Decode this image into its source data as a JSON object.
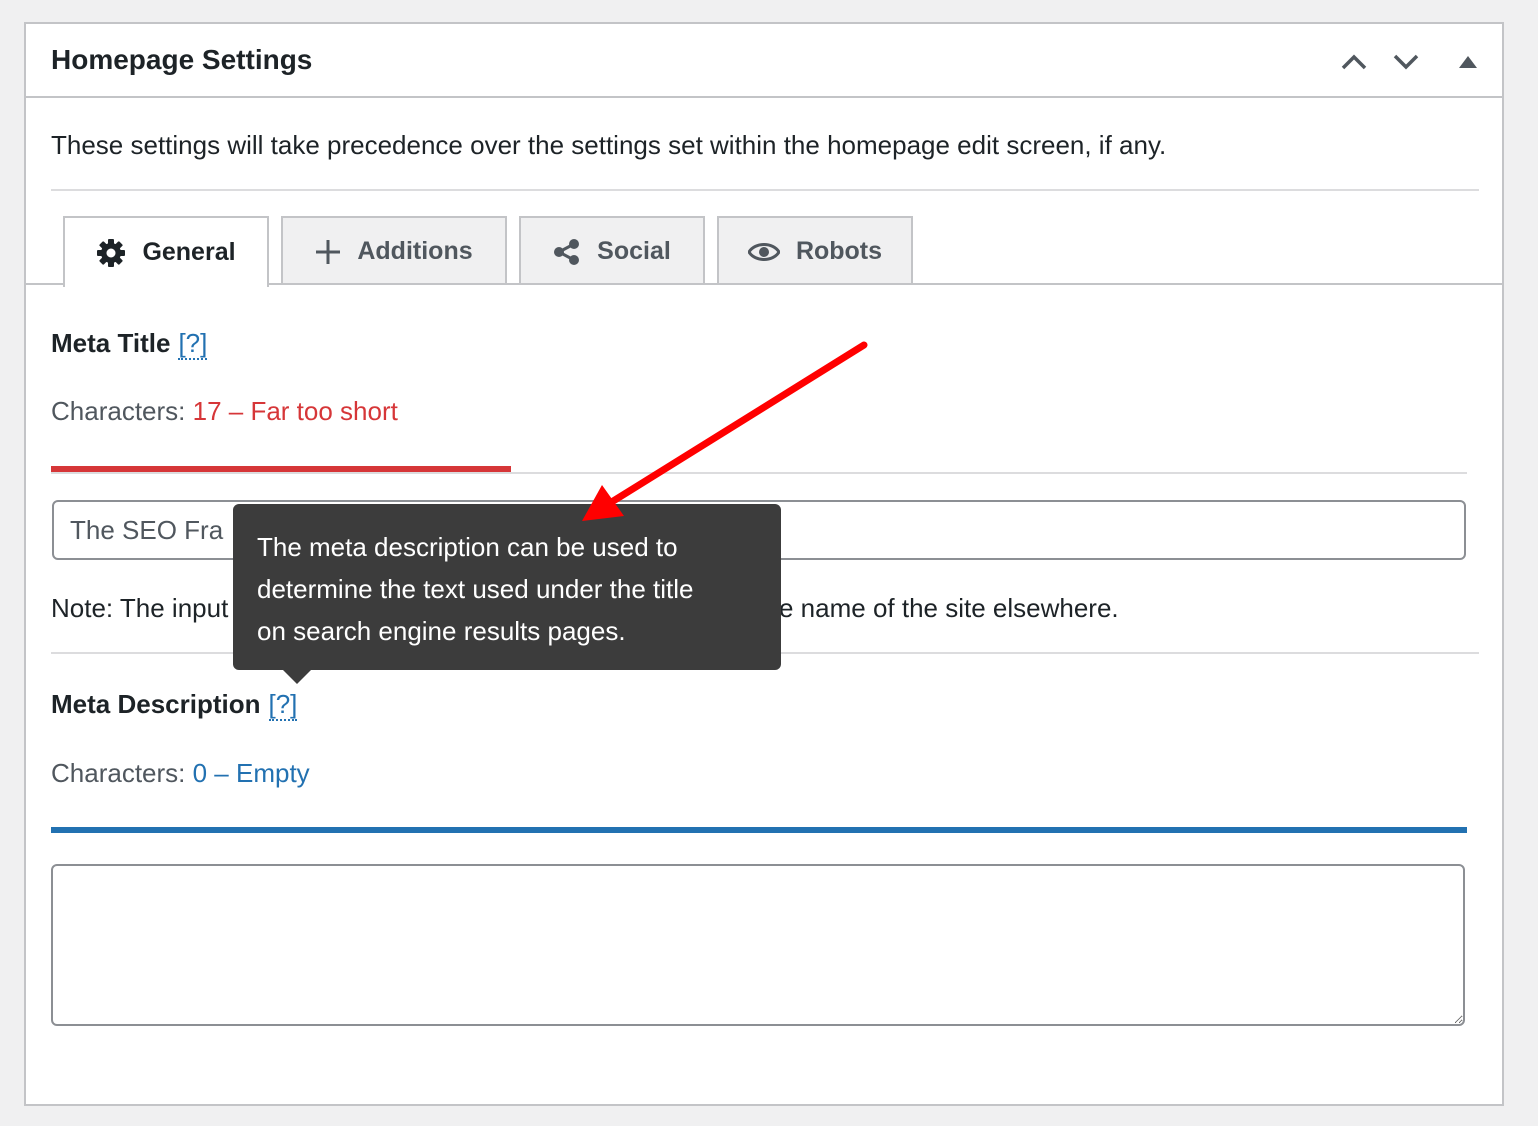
{
  "panel": {
    "title": "Homepage Settings",
    "intro": "These settings will take precedence over the settings set within the homepage edit screen, if any."
  },
  "header_controls": [
    {
      "name": "move-up",
      "icon": "chevron-up-icon"
    },
    {
      "name": "move-down",
      "icon": "chevron-down-icon"
    },
    {
      "name": "toggle-panel",
      "icon": "triangle-up-icon"
    }
  ],
  "tabs": [
    {
      "label": "General",
      "icon": "gear-icon",
      "active": true
    },
    {
      "label": "Additions",
      "icon": "plus-icon",
      "active": false
    },
    {
      "label": "Social",
      "icon": "share-icon",
      "active": false
    },
    {
      "label": "Robots",
      "icon": "eye-icon",
      "active": false
    }
  ],
  "meta_title": {
    "label": "Meta Title",
    "help": "[?]",
    "counter_prefix": "Characters:",
    "counter_value": "17 – Far too short",
    "counter_color": "#d63638",
    "bar_fill": 0.325,
    "value": "The SEO Fra",
    "note": "Note: The input",
    "note_tail": "e name of the site elsewhere."
  },
  "meta_description": {
    "label": "Meta Description",
    "help": "[?]",
    "counter_prefix": "Characters:",
    "counter_value": "0 – Empty",
    "counter_color": "#2271b1",
    "bar_fill": 1.0,
    "value": ""
  },
  "tooltip": {
    "lines": [
      "The meta description can be used to",
      "determine the text used under the title",
      "on search engine results pages."
    ]
  },
  "colors": {
    "short_bar": "#d63638",
    "empty_bar": "#2271b1",
    "annotation_arrow": "#ff0000"
  }
}
